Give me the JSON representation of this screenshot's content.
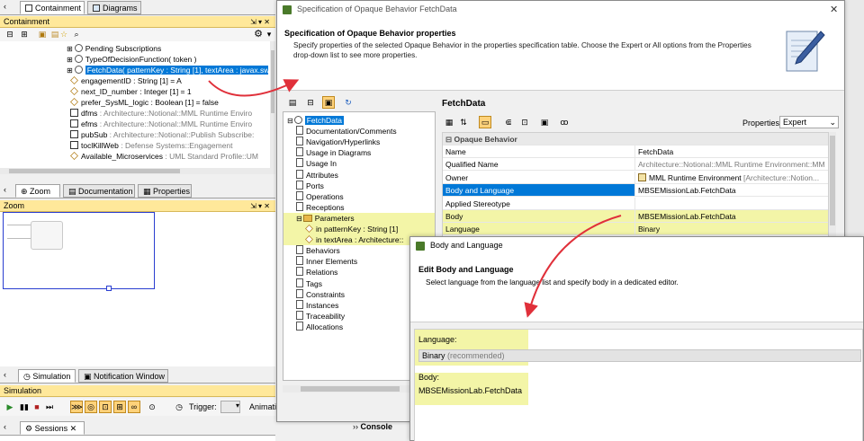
{
  "left": {
    "tabs": [
      {
        "label": "Containment",
        "active": true
      },
      {
        "label": "Diagrams",
        "active": false
      }
    ],
    "containment_title": "Containment",
    "tree_items": [
      {
        "text": "Pending Subscriptions",
        "suffix": "",
        "icon": "signal-icon",
        "indent": 0,
        "selected": false
      },
      {
        "text": "TypeOfDecisionFunction( token )",
        "suffix": "",
        "icon": "signal-icon",
        "indent": 0,
        "selected": false
      },
      {
        "text": "FetchData( patternKey : String [1], textArea : javax.sw",
        "suffix": "",
        "icon": "signal-icon",
        "indent": 0,
        "selected": true
      },
      {
        "text": "engagementID : String [1] = A",
        "suffix": "",
        "icon": "property-diamond-icon",
        "indent": 1,
        "selected": false
      },
      {
        "text": "next_ID_number : Integer [1] = 1",
        "suffix": "",
        "icon": "property-diamond-icon",
        "indent": 1,
        "selected": false
      },
      {
        "text": "prefer_SysML_logic : Boolean [1] = false",
        "suffix": "",
        "icon": "property-diamond-icon",
        "indent": 1,
        "selected": false
      },
      {
        "text": "dfms",
        "suffix": " : Architecture::Notional::MML Runtime Enviro",
        "icon": "port-icon",
        "indent": 1,
        "selected": false
      },
      {
        "text": "efms",
        "suffix": " : Architecture::Notional::MML Runtime Enviro",
        "icon": "port-icon",
        "indent": 1,
        "selected": false
      },
      {
        "text": "pubSub",
        "suffix": " : Architecture::Notional::Publish Subscribe:",
        "icon": "port-icon",
        "indent": 1,
        "selected": false
      },
      {
        "text": "toclKillWeb",
        "suffix": " : Defense Systems::Engagement",
        "icon": "port-icon",
        "indent": 1,
        "selected": false
      },
      {
        "text": "Available_Microservices",
        "suffix": " : UML Standard Profile::UM",
        "icon": "property-diamond-icon",
        "indent": 1,
        "selected": false
      }
    ],
    "mid_tabs": [
      {
        "label": "Zoom",
        "active": true
      },
      {
        "label": "Documentation",
        "active": false
      },
      {
        "label": "Properties",
        "active": false
      }
    ],
    "zoom_title": "Zoom",
    "bottom_tabs": [
      {
        "label": "Simulation",
        "active": true
      },
      {
        "label": "Notification Window",
        "active": false
      }
    ],
    "simulation_title": "Simulation",
    "trigger_label": "Trigger:",
    "animation_label": "Animati",
    "sessions_tab": "Sessions",
    "console_tab": "Console"
  },
  "spec": {
    "window_title": "Specification of Opaque Behavior FetchData",
    "header_title": "Specification of Opaque Behavior properties",
    "header_desc_1": "Specify properties of the selected Opaque Behavior in the properties specification table. Choose the Expert or All options from the Properties",
    "header_desc_2": "drop-down list to see more properties.",
    "element_name": "FetchData",
    "properties_label": "Properties:",
    "properties_value": "Expert",
    "group_label": "Opaque Behavior",
    "nav_items": [
      {
        "text": "FetchData",
        "indent": 0,
        "selected": true,
        "icon": "behavior-icon",
        "highlight": false
      },
      {
        "text": "Documentation/Comments",
        "indent": 1,
        "selected": false,
        "icon": "page-icon",
        "highlight": false
      },
      {
        "text": "Navigation/Hyperlinks",
        "indent": 1,
        "selected": false,
        "icon": "page-icon",
        "highlight": false
      },
      {
        "text": "Usage in Diagrams",
        "indent": 1,
        "selected": false,
        "icon": "page-icon",
        "highlight": false
      },
      {
        "text": "Usage In",
        "indent": 1,
        "selected": false,
        "icon": "page-icon",
        "highlight": false
      },
      {
        "text": "Attributes",
        "indent": 1,
        "selected": false,
        "icon": "page-icon",
        "highlight": false
      },
      {
        "text": "Ports",
        "indent": 1,
        "selected": false,
        "icon": "page-icon",
        "highlight": false
      },
      {
        "text": "Operations",
        "indent": 1,
        "selected": false,
        "icon": "page-icon",
        "highlight": false
      },
      {
        "text": "Receptions",
        "indent": 1,
        "selected": false,
        "icon": "page-icon",
        "highlight": false
      },
      {
        "text": "Parameters",
        "indent": 1,
        "selected": false,
        "icon": "folder-icon",
        "highlight": true
      },
      {
        "text": "in patternKey : String [1]",
        "indent": 2,
        "selected": false,
        "icon": "parameter-icon",
        "highlight": true
      },
      {
        "text": "in textArea : Architecture::",
        "indent": 2,
        "selected": false,
        "icon": "parameter-icon",
        "highlight": true
      },
      {
        "text": "Behaviors",
        "indent": 1,
        "selected": false,
        "icon": "page-icon",
        "highlight": false
      },
      {
        "text": "Inner Elements",
        "indent": 1,
        "selected": false,
        "icon": "page-icon",
        "highlight": false
      },
      {
        "text": "Relations",
        "indent": 1,
        "selected": false,
        "icon": "page-icon",
        "highlight": false
      },
      {
        "text": "Tags",
        "indent": 1,
        "selected": false,
        "icon": "page-icon",
        "highlight": false
      },
      {
        "text": "Constraints",
        "indent": 1,
        "selected": false,
        "icon": "page-icon",
        "highlight": false
      },
      {
        "text": "Instances",
        "indent": 1,
        "selected": false,
        "icon": "page-icon",
        "highlight": false
      },
      {
        "text": "Traceability",
        "indent": 1,
        "selected": false,
        "icon": "page-icon",
        "highlight": false
      },
      {
        "text": "Allocations",
        "indent": 1,
        "selected": false,
        "icon": "page-icon",
        "highlight": false
      }
    ],
    "props": [
      {
        "name": "Name",
        "value": "FetchData",
        "value_gray": "",
        "selected": false,
        "highlight": false,
        "icon": ""
      },
      {
        "name": "Qualified Name",
        "value": "",
        "value_gray": "Architecture::Notional::MML Runtime Environment::MM",
        "selected": false,
        "highlight": false,
        "icon": ""
      },
      {
        "name": "Owner",
        "value": "MML Runtime Environment ",
        "value_gray": "[Architecture::Notion...",
        "selected": false,
        "highlight": false,
        "icon": "block-icon"
      },
      {
        "name": "Body and Language",
        "value": "MBSEMissionLab.FetchData",
        "value_gray": "",
        "selected": true,
        "highlight": false,
        "icon": ""
      },
      {
        "name": "Applied Stereotype",
        "value": "",
        "value_gray": "",
        "selected": false,
        "highlight": false,
        "icon": ""
      },
      {
        "name": "Body",
        "value": "MBSEMissionLab.FetchData",
        "value_gray": "",
        "selected": false,
        "highlight": true,
        "icon": ""
      },
      {
        "name": "Language",
        "value": "Binary",
        "value_gray": "",
        "selected": false,
        "highlight": true,
        "icon": ""
      }
    ]
  },
  "bal": {
    "window_title": "Body and Language",
    "header_title": "Edit Body and Language",
    "header_desc": "Select language from the language list and specify body in a dedicated editor.",
    "language_label": "Language:",
    "language_value": "Binary",
    "language_hint": " (recommended)",
    "body_label": "Body:",
    "body_value": "MBSEMissionLab.FetchData"
  },
  "colors": {
    "selection": "#0078d7",
    "highlight": "#ecf078",
    "arrow": "#e0303a"
  }
}
